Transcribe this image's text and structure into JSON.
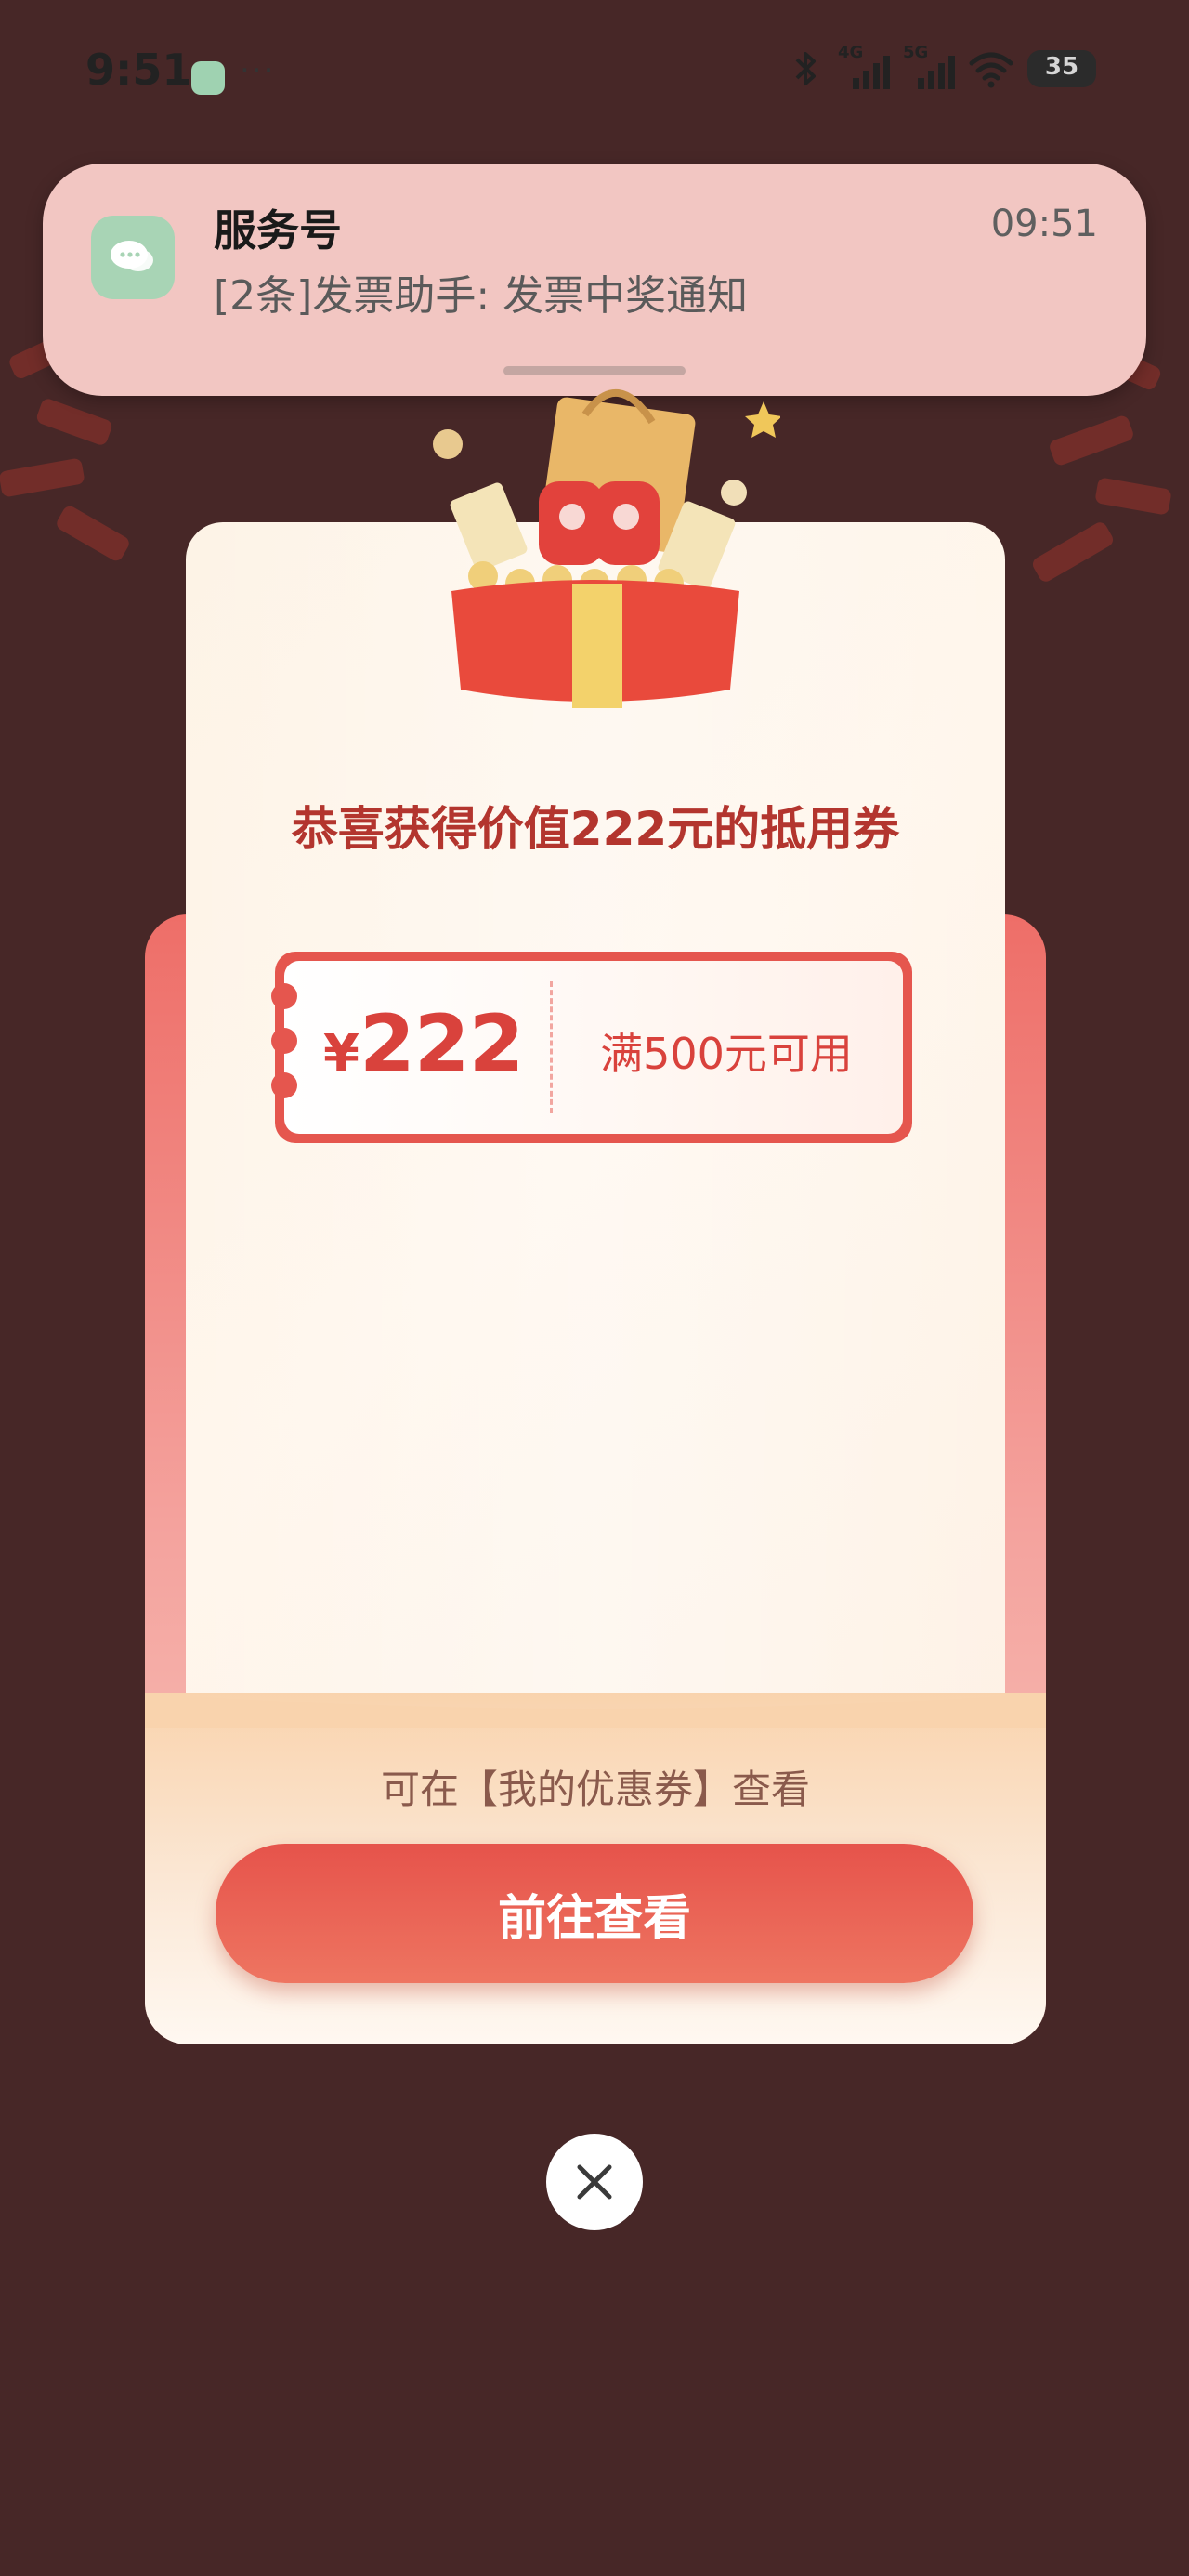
{
  "status_bar": {
    "time": "9:51",
    "more": "···",
    "signal_1_label": "4G",
    "signal_2_label": "5G",
    "battery": "35"
  },
  "notification": {
    "title": "服务号",
    "body": "[2条]发票助手: 发票中奖通知",
    "time": "09:51",
    "icon": "chat-bubbles-icon"
  },
  "modal": {
    "congrats": "恭喜获得价值222元的抵用券",
    "coupon": {
      "currency": "¥",
      "amount": "222",
      "condition": "满500元可用"
    },
    "hint": "可在【我的优惠券】查看",
    "cta_label": "前往查看"
  },
  "colors": {
    "background": "#472727",
    "notification_bg": "#f2c6c2",
    "accent_red": "#e5564e",
    "title_red": "#b3352e"
  },
  "icons": {
    "close": "close-icon",
    "gift": "gift-box-illustration"
  }
}
